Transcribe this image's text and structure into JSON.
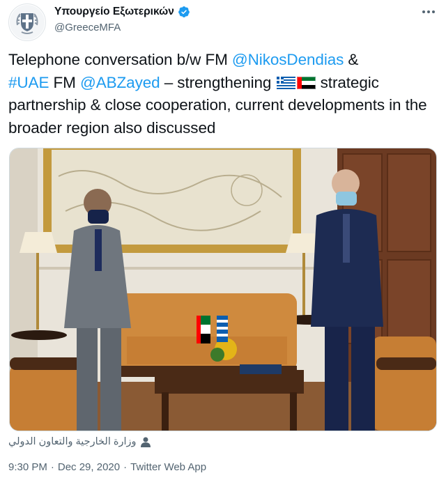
{
  "tweet": {
    "display_name": "Υπουργείο Εξωτερικών",
    "handle": "@GreeceMFA",
    "text": {
      "part1": "Telephone conversation b/w FM ",
      "mention1": "@NikosDendias",
      "part2": " & ",
      "hashtag": "#UAE",
      "part3": " FM ",
      "mention2": "@ABZayed",
      "part4": " – strengthening ",
      "part5": " strategic partnership & close cooperation, current developments in the broader region also discussed"
    },
    "flags": [
      "greece-flag-icon",
      "uae-flag-icon"
    ],
    "source_tag": "وزارة الخارجية والتعاون الدولي",
    "time": "9:30 PM",
    "date": "Dec 29, 2020",
    "client": "Twitter Web App"
  },
  "colors": {
    "link": "#1d9bf0",
    "secondary_text": "#536471",
    "verified": "#1d9bf0",
    "greek_blue": "#0d5eaf"
  }
}
